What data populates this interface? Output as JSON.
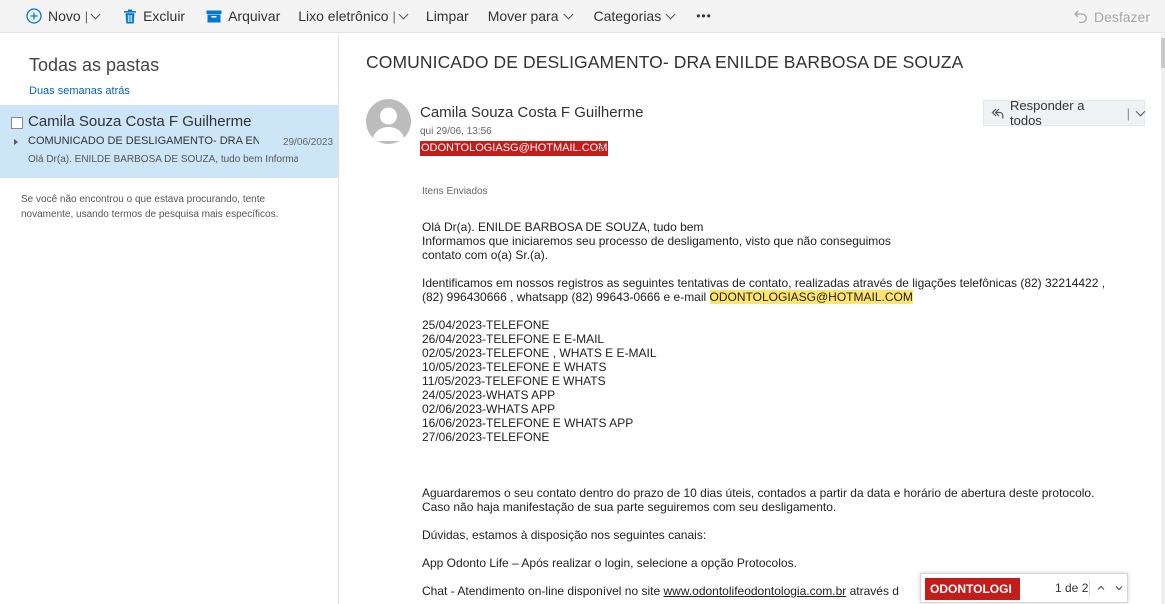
{
  "toolbar": {
    "new_label": "Novo",
    "delete_label": "Excluir",
    "archive_label": "Arquivar",
    "junk_label": "Lixo eletrônico",
    "sweep_label": "Limpar",
    "move_label": "Mover para",
    "categories_label": "Categorias",
    "more_label": "•••",
    "undo_label": "Desfazer",
    "accent_color": "#0078d4"
  },
  "left": {
    "title": "Todas as pastas",
    "group_label": "Duas semanas atrás",
    "message": {
      "from": "Camila Souza Costa F Guilherme",
      "subject": "COMUNICADO DE DESLIGAMENTO- DRA ENILDE BARBOSA DE SOUZA",
      "date": "29/06/2023",
      "preview": "Olá Dr(a). ENILDE BARBOSA DE SOUZA, tudo bem Informamos que iniciaremos seu processo de desligamento"
    },
    "hint": "Se você não encontrou o que estava procurando, tente novamente, usando termos de pesquisa mais específicos."
  },
  "reading": {
    "subject": "COMUNICADO DE DESLIGAMENTO- DRA ENILDE BARBOSA DE SOUZA",
    "sender": "Camila Souza Costa F Guilherme",
    "sent_date": "qui 29/06, 13:56",
    "to": "ODONTOLOGIASG@HOTMAIL.COM",
    "reply_label": "Responder a todos",
    "folder_label": "Itens Enviados",
    "greeting": "Olá Dr(a). ENILDE BARBOSA DE SOUZA, tudo bem",
    "intro_1": "Informamos que iniciaremos seu processo de desligamento, visto que não conseguimos",
    "intro_2": "contato com o(a) Sr.(a).",
    "attempts_1": "Identificamos em nossos registros as seguintes tentativas de contato, realizadas através de ligações telefônicas (82) 32214422 ,",
    "attempts_2": "(82) 996430666 , whatsapp (82) 99643-0666 e e-mail ",
    "attempts_email": "ODONTOLOGIASG@HOTMAIL.COM",
    "log": [
      "25/04/2023-TELEFONE",
      "26/04/2023-TELEFONE E E-MAIL",
      "02/05/2023-TELEFONE , WHATS E E-MAIL",
      "10/05/2023-TELEFONE E WHATS",
      "11/05/2023-TELEFONE E WHATS",
      "24/05/2023-WHATS APP",
      "02/06/2023-WHATS APP",
      "16/06/2023-TELEFONE E WHATS APP",
      "27/06/2023-TELEFONE"
    ],
    "wait_1": "Aguardaremos o seu contato dentro do prazo de 10 dias úteis, contados a partir da data e horário de abertura deste protocolo.",
    "wait_2": "Caso não haja manifestação de sua parte seguiremos com seu desligamento.",
    "doubts": "Dúvidas, estamos à disposição nos seguintes canais:",
    "app": "App Odonto Life – Após realizar o login, selecione a opção Protocolos.",
    "chat_prefix": "Chat - Atendimento on-line disponível no site ",
    "chat_link": "www.odontolifeodontologia.com.br",
    "chat_suffix": " através d"
  },
  "find": {
    "query": "ODONTOLOGI",
    "count": "1 de 2",
    "highlight_color": "#c41b1b"
  }
}
